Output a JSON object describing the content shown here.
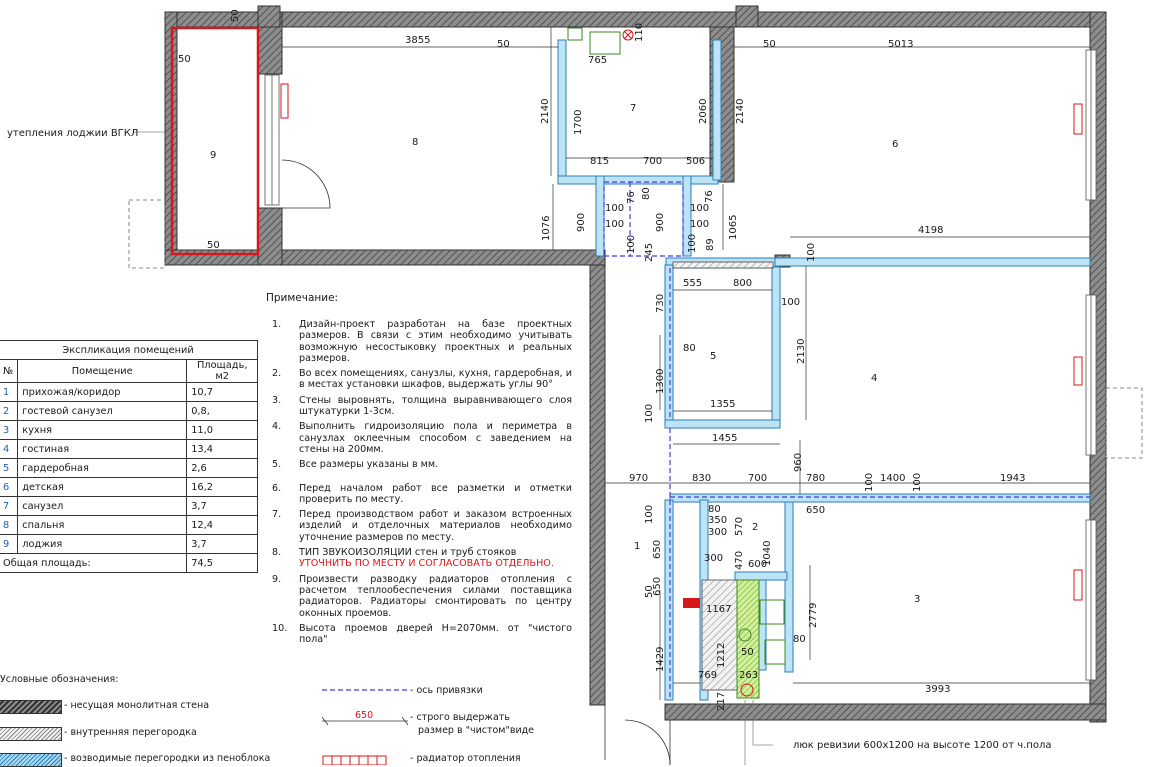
{
  "plan": {
    "room_numbers": [
      "1",
      "2",
      "3",
      "4",
      "5",
      "6",
      "7",
      "8",
      "9"
    ],
    "dims": {
      "d3855": "3855",
      "d5013": "5013",
      "d50a": "50",
      "d50b": "50",
      "d50c": "50",
      "d50d": "50",
      "d50e": "50",
      "d765": "765",
      "d110": "110",
      "d2140a": "2140",
      "d1700": "1700",
      "d2060": "2060",
      "d2140b": "2140",
      "d815": "815",
      "d700a": "700",
      "d506": "506",
      "d76a": "76",
      "d80a": "80",
      "d76b": "76",
      "d100a": "100",
      "d100b": "100",
      "d100c": "100",
      "d100d": "100",
      "d100e": "100",
      "d100f": "100",
      "d1076": "1076",
      "d900a": "900",
      "d900b": "900",
      "d1065": "1065",
      "d245": "245",
      "d89": "89",
      "d4198": "4198",
      "d100g": "100",
      "d555": "555",
      "d800": "800",
      "d100h": "100",
      "d730": "730",
      "d80b": "80",
      "d2130": "2130",
      "d1300": "1300",
      "d100i": "100",
      "d1355": "1355",
      "d1455": "1455",
      "d960": "960",
      "d970": "970",
      "d830": "830",
      "d700b": "700",
      "d780": "780",
      "d100j": "100",
      "d1400": "1400",
      "d100k": "100",
      "d1943": "1943",
      "d100l": "100",
      "d650a": "650",
      "d80c": "80",
      "d350": "350",
      "d300a": "300",
      "d570": "570",
      "d650b": "650",
      "d1040": "1040",
      "d470": "470",
      "d300b": "300",
      "d600": "600",
      "d650c": "650",
      "d50f": "50",
      "d1167": "1167",
      "d2779": "2779",
      "d80d": "80",
      "d1212": "1212",
      "d50g": "50",
      "d1429": "1429",
      "d769": "769",
      "d263": "263",
      "d217": "217",
      "d3993": "3993"
    }
  },
  "loggia_label": "утепления лоджии ВГКЛ",
  "hatch_note": "люк ревизии 600х1200 на высоте 1200 от ч.пола",
  "notes": {
    "title": "Примечание:",
    "items": [
      {
        "num": "1.",
        "text": "Дизайн-проект разработан на базе проектных размеров. В связи с этим необходимо учитывать возможную несостыковку проектных и реальных размеров."
      },
      {
        "num": "2.",
        "text": "Во всех помещениях, санузлы, кухня, гардеробная, и в местах установки шкафов, выдержать углы 90°"
      },
      {
        "num": "3.",
        "text": "Стены выровнять, толщина выравнивающего слоя штукатурки 1-3см."
      },
      {
        "num": "4.",
        "text": "Выполнить гидроизоляцию пола и периметра в санузлах оклеечным способом с заведением на стены на 200мм."
      },
      {
        "num": "5.",
        "text": "Все размеры указаны в мм."
      },
      {
        "num": "6.",
        "text": "Перед началом работ все разметки и отметки проверить по месту."
      },
      {
        "num": "7.",
        "text": "Перед производством работ и заказом встроенных изделий и отделочных материалов необходимо уточнение размеров по месту."
      },
      {
        "num": "8.",
        "text": "ТИП ЗВУКОИЗОЛЯЦИИ стен и труб стояков",
        "red": "УТОЧНИТЬ ПО МЕСТУ И СОГЛАСОВАТЬ ОТДЕЛЬНО."
      },
      {
        "num": "9.",
        "text": "Произвести разводку радиаторов отопления с расчетом теплообеспечения силами поставщика радиаторов. Радиаторы смонтировать по центру оконных проемов."
      },
      {
        "num": "10.",
        "text": "Высота проемов дверей Н=2070мм. от \"чистого пола\""
      }
    ]
  },
  "explication": {
    "title": "Экспликация помещений",
    "headers": [
      "№",
      "Помещение",
      "Площадь, м2"
    ],
    "rows": [
      {
        "no": "1",
        "name": "прихожая/коридор",
        "area": "10,7"
      },
      {
        "no": "2",
        "name": "гостевой санузел",
        "area": "0,8,"
      },
      {
        "no": "3",
        "name": "кухня",
        "area": "11,0"
      },
      {
        "no": "4",
        "name": "гостиная",
        "area": "13,4"
      },
      {
        "no": "5",
        "name": "гардеробная",
        "area": "2,6"
      },
      {
        "no": "6",
        "name": "детская",
        "area": "16,2"
      },
      {
        "no": "7",
        "name": "санузел",
        "area": "3,7"
      },
      {
        "no": "8",
        "name": "спальня",
        "area": "12,4"
      },
      {
        "no": "9",
        "name": "лоджия",
        "area": "3,7"
      }
    ],
    "total_label": "Общая площадь:",
    "total_value": "74,5"
  },
  "legend": {
    "title": "Условные обозначения:",
    "items": [
      "- несущая монолитная стена",
      "- внутренняя перегородка",
      "- возводимые перегородки из пеноблока"
    ],
    "axis": "- ось привязки",
    "strict_value": "650",
    "strict_line1": "- строго выдержать",
    "strict_line2": "размер в \"чистом\"виде",
    "radiator": "- радиатор отопления"
  }
}
